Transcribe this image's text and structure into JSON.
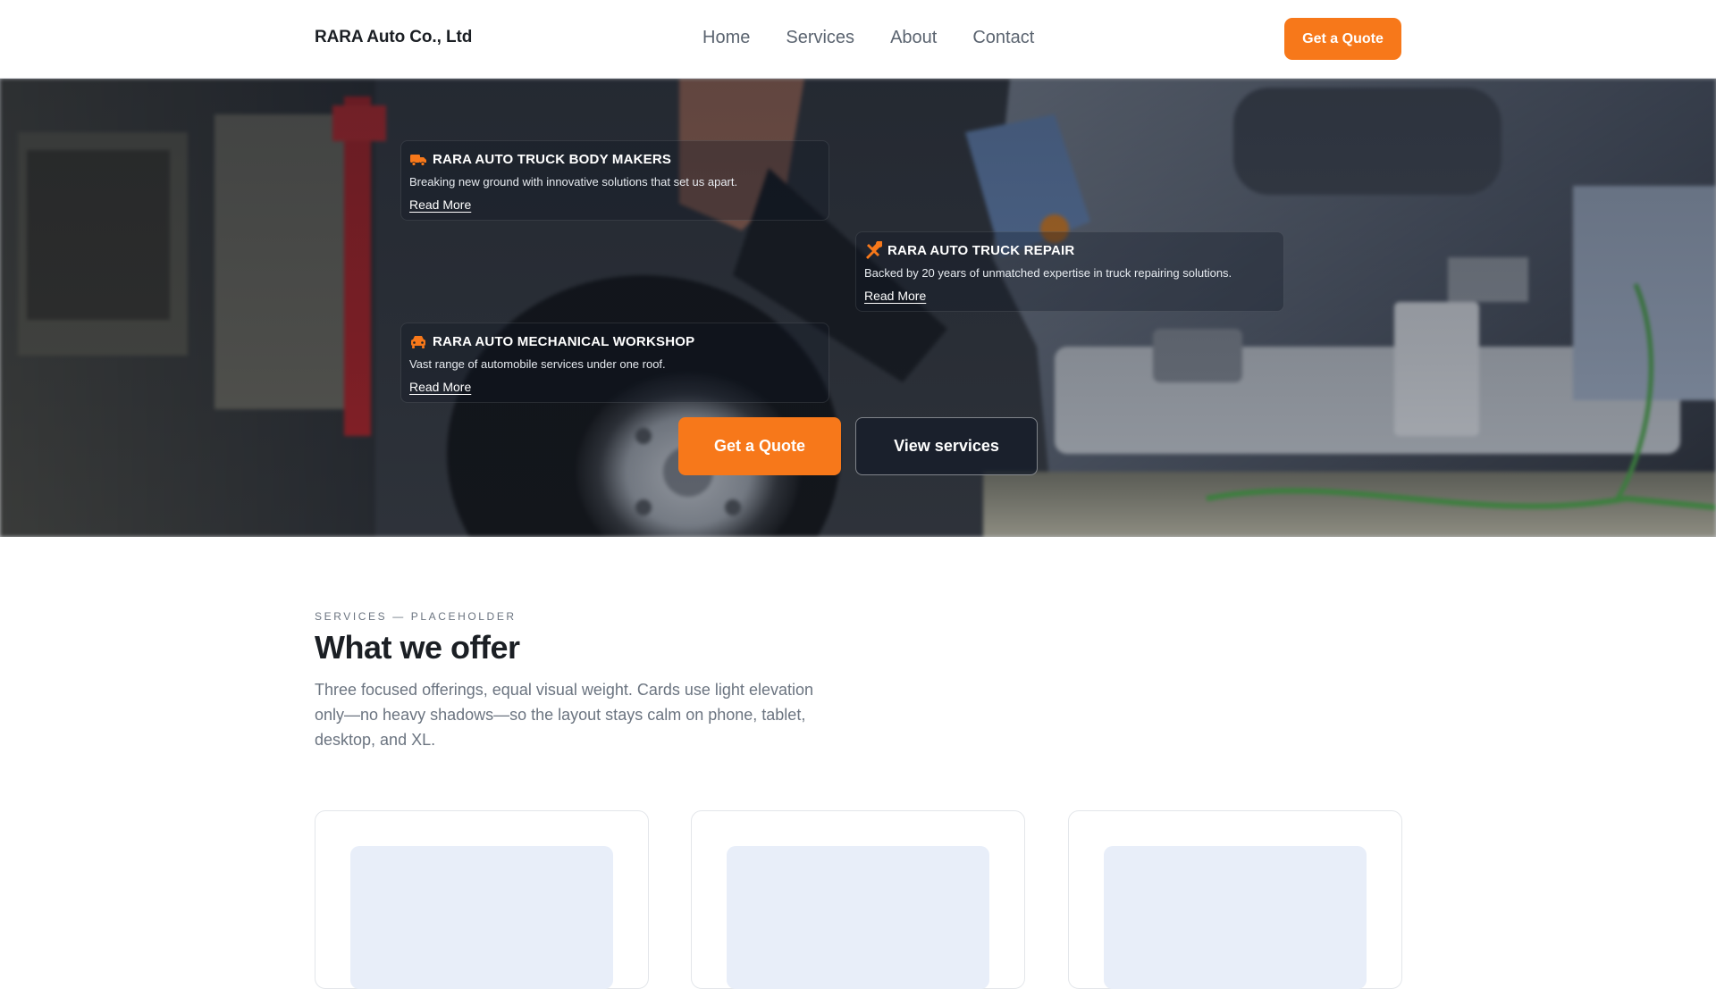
{
  "header": {
    "brand": "RARA Auto Co., Ltd",
    "nav": [
      {
        "label": "Home"
      },
      {
        "label": "Services"
      },
      {
        "label": "About"
      },
      {
        "label": "Contact"
      }
    ],
    "cta_label": "Get a Quote"
  },
  "hero": {
    "cards": [
      {
        "icon": "truck-icon",
        "title": "RARA AUTO TRUCK BODY MAKERS",
        "description": "Breaking new ground with innovative solutions that set us apart.",
        "link": "Read More"
      },
      {
        "icon": "tools-icon",
        "title": "RARA AUTO TRUCK REPAIR",
        "description": "Backed by 20 years of unmatched expertise in truck repairing solutions.",
        "link": "Read More"
      },
      {
        "icon": "car-icon",
        "title": "RARA AUTO MECHANICAL WORKSHOP",
        "description": "Vast range of automobile services under one roof.",
        "link": "Read More"
      }
    ],
    "primary_cta": "Get a Quote",
    "secondary_cta": "View services"
  },
  "services": {
    "eyebrow": "SERVICES — PLACEHOLDER",
    "title": "What we offer",
    "lead": "Three focused offerings, equal visual weight. Cards use light elevation only—no heavy shadows—so the layout stays calm on phone, tablet, desktop, and XL."
  },
  "colors": {
    "accent": "#f7781a",
    "text_dark": "#1b1f24",
    "text_muted": "#6b7480",
    "card_media": "#e8eef9"
  }
}
